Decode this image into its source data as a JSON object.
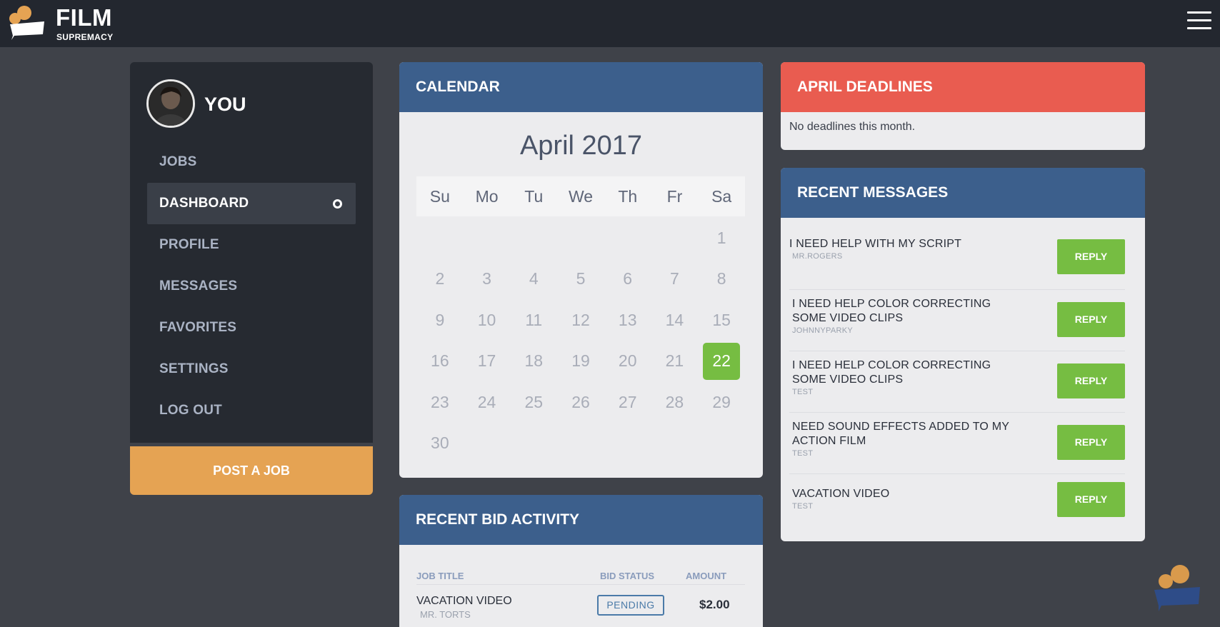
{
  "brand": {
    "name_top": "FILM",
    "name_bottom": "SUPREMACY",
    "accent": "#e5a353"
  },
  "sidebar": {
    "user_name": "YOU",
    "items": [
      {
        "label": "JOBS"
      },
      {
        "label": "DASHBOARD",
        "active": true
      },
      {
        "label": "PROFILE"
      },
      {
        "label": "MESSAGES"
      },
      {
        "label": "FAVORITES"
      },
      {
        "label": "SETTINGS"
      },
      {
        "label": "LOG OUT"
      }
    ],
    "post_job_label": "POST A JOB"
  },
  "calendar": {
    "title": "CALENDAR",
    "month_label": "April 2017",
    "weekdays": [
      "Su",
      "Mo",
      "Tu",
      "We",
      "Th",
      "Fr",
      "Sa"
    ],
    "first_weekday_index": 6,
    "days_in_month": 30,
    "selected_day": 22,
    "selected_color": "#76bd42"
  },
  "bids": {
    "title": "RECENT BID ACTIVITY",
    "columns": [
      "JOB TITLE",
      "BID STATUS",
      "AMOUNT"
    ],
    "rows": [
      {
        "job_title": "VACATION VIDEO",
        "client": "MR. TORTS",
        "status": "PENDING",
        "amount": "$2.00"
      }
    ]
  },
  "deadlines": {
    "title": "APRIL DEADLINES",
    "empty_text": "No deadlines this month.",
    "header_color": "#e95c50"
  },
  "messages": {
    "title": "RECENT MESSAGES",
    "reply_label": "REPLY",
    "items": [
      {
        "title": "I NEED HELP WITH MY SCRIPT",
        "from": "MR.ROGERS"
      },
      {
        "title": "I NEED HELP COLOR CORRECTING SOME VIDEO CLIPS",
        "from": "JOHNNYPARKY"
      },
      {
        "title": "I NEED HELP COLOR CORRECTING SOME VIDEO CLIPS",
        "from": "TEST"
      },
      {
        "title": "NEED SOUND EFFECTS ADDED TO MY ACTION FILM",
        "from": "TEST"
      },
      {
        "title": "VACATION VIDEO",
        "from": "TEST"
      }
    ]
  },
  "colors": {
    "panel_header": "#3c5f8c",
    "reply_button": "#76bd42",
    "topbar": "#23272f"
  }
}
